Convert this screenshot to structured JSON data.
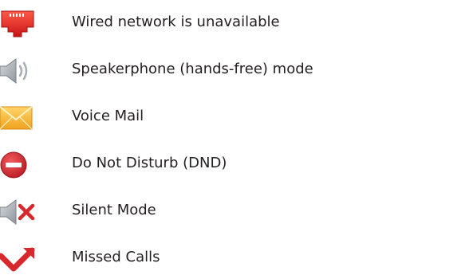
{
  "colors": {
    "text": "#231f20",
    "network_red": "#e02020",
    "speaker_gray": "#a7adb2",
    "mail_yellow": "#f6b733",
    "dnd_red": "#d8282e",
    "cross_red": "#d8282e",
    "missed_red": "#d8282e"
  },
  "items": [
    {
      "icon": "wired-network-icon",
      "label": "Wired network is unavailable"
    },
    {
      "icon": "speakerphone-icon",
      "label": "Speakerphone (hands-free) mode"
    },
    {
      "icon": "voice-mail-icon",
      "label": "Voice Mail"
    },
    {
      "icon": "do-not-disturb-icon",
      "label": "Do Not Disturb (DND)"
    },
    {
      "icon": "silent-mode-icon",
      "label": "Silent Mode"
    },
    {
      "icon": "missed-calls-icon",
      "label": "Missed Calls"
    }
  ]
}
